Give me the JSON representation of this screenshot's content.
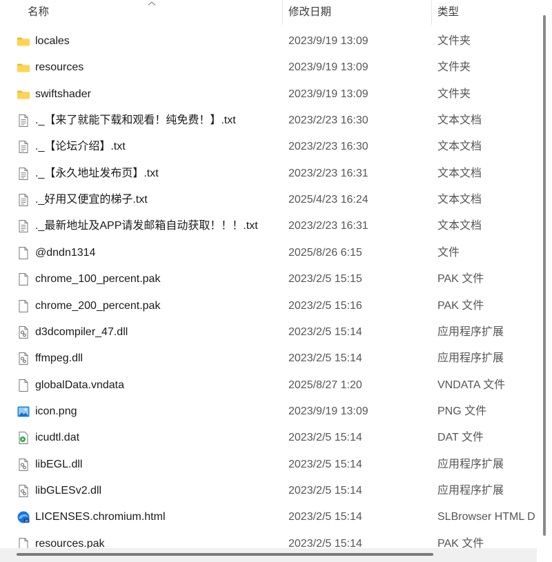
{
  "header": {
    "name": "名称",
    "date": "修改日期",
    "type": "类型"
  },
  "files": [
    {
      "name": "locales",
      "date": "2023/9/19 13:09",
      "type": "文件夹",
      "icon": "folder-icon"
    },
    {
      "name": "resources",
      "date": "2023/9/19 13:09",
      "type": "文件夹",
      "icon": "folder-icon"
    },
    {
      "name": "swiftshader",
      "date": "2023/9/19 13:09",
      "type": "文件夹",
      "icon": "folder-icon"
    },
    {
      "name": "._【来了就能下载和观看！纯免费！】.txt",
      "date": "2023/2/23 16:30",
      "type": "文本文档",
      "icon": "text-file-icon"
    },
    {
      "name": "._【论坛介绍】.txt",
      "date": "2023/2/23 16:30",
      "type": "文本文档",
      "icon": "text-file-icon"
    },
    {
      "name": "._【永久地址发布页】.txt",
      "date": "2023/2/23 16:31",
      "type": "文本文档",
      "icon": "text-file-icon"
    },
    {
      "name": "._好用又便宜的梯子.txt",
      "date": "2025/4/23 16:24",
      "type": "文本文档",
      "icon": "text-file-icon"
    },
    {
      "name": "._最新地址及APP请发邮箱自动获取！！！.txt",
      "date": "2023/2/23 16:31",
      "type": "文本文档",
      "icon": "text-file-icon"
    },
    {
      "name": "@dndn1314",
      "date": "2025/8/26 6:15",
      "type": "文件",
      "icon": "blank-file-icon"
    },
    {
      "name": "chrome_100_percent.pak",
      "date": "2023/2/5 15:15",
      "type": "PAK 文件",
      "icon": "blank-file-icon"
    },
    {
      "name": "chrome_200_percent.pak",
      "date": "2023/2/5 15:16",
      "type": "PAK 文件",
      "icon": "blank-file-icon"
    },
    {
      "name": "d3dcompiler_47.dll",
      "date": "2023/2/5 15:14",
      "type": "应用程序扩展",
      "icon": "dll-file-icon"
    },
    {
      "name": "ffmpeg.dll",
      "date": "2023/2/5 15:14",
      "type": "应用程序扩展",
      "icon": "dll-file-icon"
    },
    {
      "name": "globalData.vndata",
      "date": "2025/8/27 1:20",
      "type": "VNDATA 文件",
      "icon": "blank-file-icon"
    },
    {
      "name": "icon.png",
      "date": "2023/9/19 13:09",
      "type": "PNG 文件",
      "icon": "image-file-icon"
    },
    {
      "name": "icudtl.dat",
      "date": "2023/2/5 15:14",
      "type": "DAT 文件",
      "icon": "media-file-icon"
    },
    {
      "name": "libEGL.dll",
      "date": "2023/2/5 15:14",
      "type": "应用程序扩展",
      "icon": "dll-file-icon"
    },
    {
      "name": "libGLESv2.dll",
      "date": "2023/2/5 15:14",
      "type": "应用程序扩展",
      "icon": "dll-file-icon"
    },
    {
      "name": "LICENSES.chromium.html",
      "date": "2023/2/5 15:14",
      "type": "SLBrowser HTML D",
      "icon": "browser-file-icon"
    },
    {
      "name": "resources.pak",
      "date": "2023/2/5 15:14",
      "type": "PAK 文件",
      "icon": "blank-file-icon"
    }
  ]
}
